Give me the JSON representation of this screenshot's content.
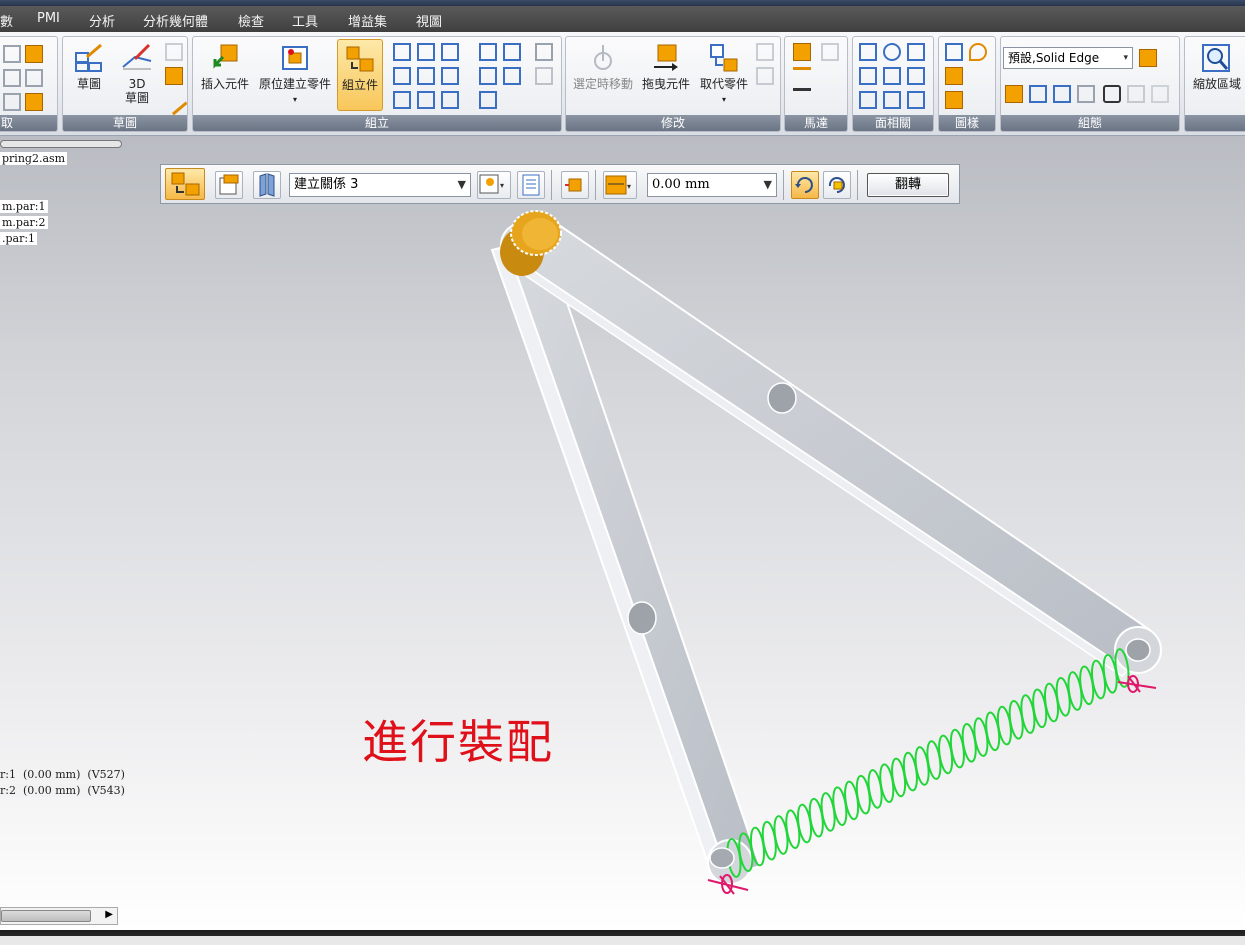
{
  "menu": {
    "items": [
      "數",
      "PMI",
      "分析",
      "分析幾何體",
      "檢查",
      "工具",
      "增益集",
      "視圖"
    ]
  },
  "ribbon": {
    "groups": {
      "select": "取",
      "sketch": "草圖",
      "assemble": "組立",
      "modify": "修改",
      "motor": "馬達",
      "face_relate": "面相關",
      "pattern": "圖樣",
      "config": "組態"
    },
    "buttons": {
      "sketch": "草圖",
      "sketch3d_line1": "3D",
      "sketch3d_line2": "草圖",
      "insert_component": "插入元件",
      "create_inplace": "原位建立零件",
      "assemble": "組立件",
      "move_selected": "選定時移動",
      "drag_component": "拖曳元件",
      "replace_part": "取代零件",
      "zoom_area": "縮放區域"
    },
    "style_combo": "預設,Solid Edge"
  },
  "pathfinder": {
    "items": [
      "pring2.asm",
      "m.par:1",
      "m.par:2",
      ".par:1"
    ],
    "relations": [
      {
        "name": "r:1",
        "offset": "(0.00 mm)",
        "id": "(V527)"
      },
      {
        "name": "r:2",
        "offset": "(0.00 mm)",
        "id": "(V543)"
      }
    ]
  },
  "command_bar": {
    "relation_combo": "建立關係 3",
    "offset_combo": "0.00 mm",
    "flip_button": "翻轉"
  },
  "viewport": {
    "overlay_text": "進行裝配"
  },
  "colors": {
    "link_fill": "#c9cdd3",
    "link_edge": "#ffffff",
    "pin": "#e2a11a",
    "spring": "#22d63a",
    "marker": "#e0186a",
    "overlay_text": "#e0101a",
    "active_button": "#f6b848"
  }
}
